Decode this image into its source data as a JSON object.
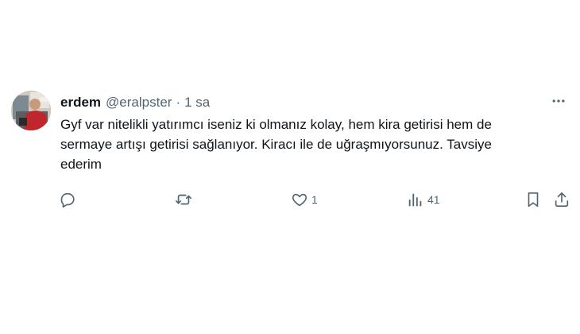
{
  "tweet": {
    "display_name": "erdem",
    "handle": "@eralpster",
    "separator": "·",
    "time": "1 sa",
    "text": "Gyf var nitelikli yatırımcı iseniz ki olmanız kolay, hem kira getirisi hem de\nsermaye artışı getirisi sağlanıyor. Kiracı ile de uğraşmıyorsunuz. Tavsiye\nederim",
    "likes": "1",
    "views": "41"
  },
  "icons": {
    "reply": "reply-icon",
    "retweet": "retweet-icon",
    "like": "heart-icon",
    "views": "views-chart-icon",
    "bookmark": "bookmark-icon",
    "share": "share-icon",
    "more": "more-horizontal-icon"
  },
  "colors": {
    "text_primary": "#0f1419",
    "text_secondary": "#536471",
    "background": "#ffffff"
  }
}
